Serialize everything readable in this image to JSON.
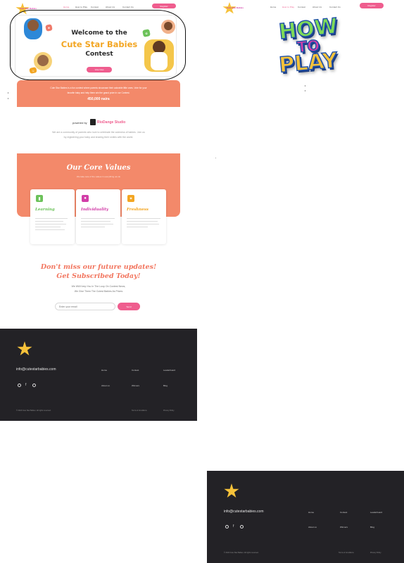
{
  "brand": {
    "logo_text": "Cute Star Babies",
    "colors": {
      "pink": "#ef5d8e",
      "salmon": "#f3896a",
      "green": "#6cc25a",
      "magenta": "#d23ea8",
      "orange": "#f3a623",
      "footer": "#232226"
    }
  },
  "nav": {
    "items": [
      "Home",
      "How to Play",
      "Contest",
      "About Us",
      "Contact Us"
    ],
    "cta": "Register"
  },
  "hero": {
    "line1": "Welcome to the",
    "line2": "Cute Star Babies",
    "line3": "Contest",
    "cta": "Vote Now"
  },
  "prize": {
    "line1": "Cute Star Babies is a fun contest where parents showcase their adorable little ones. Vote for your",
    "line2": "favorite baby and help them win the grand prize in our Contest.",
    "amount": "450,000 naira"
  },
  "powered": {
    "label": "powered by",
    "studio": "RioDange Studio",
    "desc1": "We are a community of parents who love to celebrate the cuteness of babies. Join us",
    "desc2": "by registering your baby and sharing their smiles with the world."
  },
  "values": {
    "title": "Our Core Values",
    "subtitle": "We take care of the values in everything we do",
    "cards": [
      {
        "title": "Learning",
        "icon": "book-icon",
        "color": "#6cc25a"
      },
      {
        "title": "Individuality",
        "icon": "person-icon",
        "color": "#d23ea8"
      },
      {
        "title": "Freshness",
        "icon": "sparkle-icon",
        "color": "#f3a623"
      }
    ]
  },
  "subscribe": {
    "line1": "Don't miss our future updates!",
    "line2": "Get Subscribed Today!",
    "text1": "We Will Keep You In The Loop On Contest News,",
    "text2": "We Give Them The Cutest Babies As Prizes",
    "placeholder": "Enter your email",
    "button": "Send"
  },
  "footer": {
    "email": "info@cutestarbabies.com",
    "links_row1": [
      "Home",
      "Contest",
      "Leaderboard"
    ],
    "links_row2": [
      "About us",
      "Winners",
      "Blog"
    ],
    "copyright": "© 2024 Cute Star Babies. All rights reserved.",
    "legal": [
      "Terms & Conditions",
      "Privacy Policy"
    ]
  },
  "howto": {
    "word1": "HOW",
    "word2": "TO",
    "word3": "PLAY"
  }
}
